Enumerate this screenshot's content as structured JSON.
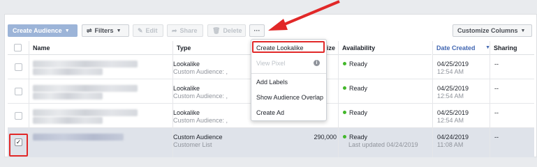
{
  "toolbar": {
    "create_audience": "Create Audience",
    "filters": "Filters",
    "edit": "Edit",
    "share": "Share",
    "delete": "Delete",
    "more": "···",
    "customize_columns": "Customize Columns"
  },
  "columns": {
    "name": "Name",
    "type": "Type",
    "size": "ize",
    "availability": "Availability",
    "date_created": "Date Created",
    "sharing": "Sharing"
  },
  "rows": [
    {
      "type": "Lookalike",
      "type_sub": "Custom Audience: ,",
      "size": "",
      "availability": "Ready",
      "availability_sub": "",
      "date": "04/25/2019",
      "time": "12:54 AM",
      "sharing": "--",
      "selected": false
    },
    {
      "type": "Lookalike",
      "type_sub": "Custom Audience: ,",
      "size": "",
      "availability": "Ready",
      "availability_sub": "",
      "date": "04/25/2019",
      "time": "12:54 AM",
      "sharing": "--",
      "selected": false
    },
    {
      "type": "Lookalike",
      "type_sub": "Custom Audience: ,",
      "size": "",
      "availability": "Ready",
      "availability_sub": "",
      "date": "04/25/2019",
      "time": "12:54 AM",
      "sharing": "--",
      "selected": false
    },
    {
      "type": "Custom Audience",
      "type_sub": "Customer List",
      "size": "290,000",
      "availability": "Ready",
      "availability_sub": "Last updated 04/24/2019",
      "date": "04/24/2019",
      "time": "11:08 AM",
      "sharing": "--",
      "selected": true
    }
  ],
  "menu": {
    "items": [
      "Create Lookalike",
      "View Pixel",
      "Add Labels",
      "Show Audience Overlap",
      "Create Ad"
    ]
  },
  "colors": {
    "highlight": "#e12828",
    "accent": "#4267b2",
    "ready": "#42b72a"
  }
}
